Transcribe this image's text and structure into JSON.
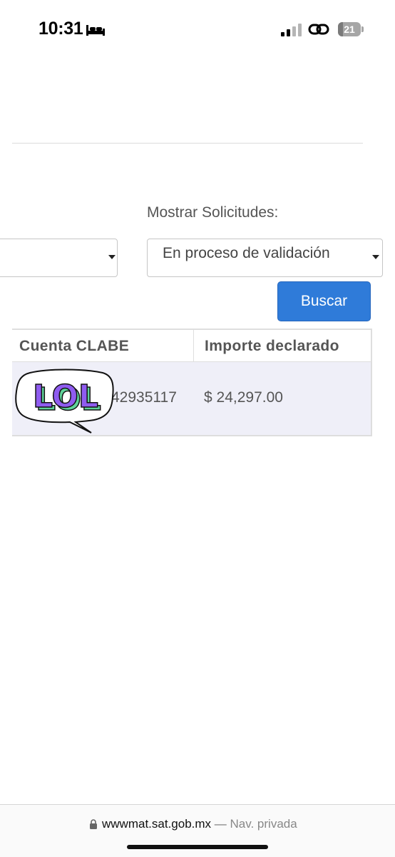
{
  "status_bar": {
    "time": "10:31",
    "battery_level": "21",
    "icons": [
      "bed-icon",
      "signal-icon",
      "link-icon",
      "battery-icon"
    ]
  },
  "filters": {
    "mostrar_label": "Mostrar Solicitudes:",
    "left_select_value": "",
    "mostrar_select_value": "En proceso de validación"
  },
  "actions": {
    "buscar_label": "Buscar"
  },
  "table": {
    "headers": [
      "Cuenta CLABE",
      "Importe declarado"
    ],
    "rows": [
      {
        "cuenta_clabe": "42935117",
        "importe_declarado": "$ 24,297.00"
      }
    ]
  },
  "sticker": {
    "text": "LOL"
  },
  "address_bar": {
    "url": "wwwmat.sat.gob.mx",
    "separator": "—",
    "mode": "Nav. privada"
  },
  "colors": {
    "primary_button": "#2f7bd9",
    "row_background": "#efeff8",
    "sticker_fill": "#8f5cf0",
    "sticker_shadow": "#5fd39a"
  }
}
